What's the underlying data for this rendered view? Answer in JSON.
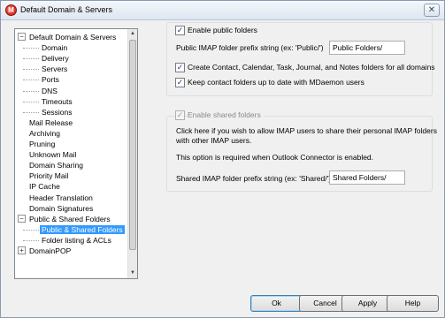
{
  "window": {
    "title": "Default Domain & Servers",
    "close_glyph": "✕"
  },
  "tree": {
    "items": [
      {
        "label": "Default Domain & Servers",
        "level": 0,
        "expander": "−"
      },
      {
        "label": "Domain",
        "level": 1
      },
      {
        "label": "Delivery",
        "level": 1
      },
      {
        "label": "Servers",
        "level": 1
      },
      {
        "label": "Ports",
        "level": 1
      },
      {
        "label": "DNS",
        "level": 1
      },
      {
        "label": "Timeouts",
        "level": 1
      },
      {
        "label": "Sessions",
        "level": 1
      },
      {
        "label": "Mail Release",
        "level": 0
      },
      {
        "label": "Archiving",
        "level": 0
      },
      {
        "label": "Pruning",
        "level": 0
      },
      {
        "label": "Unknown Mail",
        "level": 0
      },
      {
        "label": "Domain Sharing",
        "level": 0
      },
      {
        "label": "Priority Mail",
        "level": 0
      },
      {
        "label": "IP Cache",
        "level": 0
      },
      {
        "label": "Header Translation",
        "level": 0
      },
      {
        "label": "Domain Signatures",
        "level": 0
      },
      {
        "label": "Public & Shared Folders",
        "level": 0,
        "expander": "−"
      },
      {
        "label": "Public & Shared Folders",
        "level": 1,
        "selected": true
      },
      {
        "label": "Folder listing & ACLs",
        "level": 1
      },
      {
        "label": "DomainPOP",
        "level": 0,
        "expander": "+"
      }
    ]
  },
  "public": {
    "enable_label": "Enable public folders",
    "enable_checked": true,
    "prefix_label": "Public IMAP folder prefix string (ex: 'Public/')",
    "prefix_value": "Public Folders/",
    "create_label": "Create Contact, Calendar, Task, Journal, and Notes folders for all domains",
    "create_checked": true,
    "keep_label": "Keep contact folders up to date with MDaemon users",
    "keep_checked": true
  },
  "shared": {
    "enable_label": "Enable shared folders",
    "enable_checked": true,
    "desc_line1": "Click here if you wish to allow IMAP users to share their personal IMAP folders",
    "desc_line2": "with other IMAP users.",
    "note": "This option is required when Outlook Connector is enabled.",
    "prefix_label": "Shared IMAP folder prefix string (ex: 'Shared/')",
    "prefix_value": "Shared Folders/"
  },
  "buttons": {
    "ok": "Ok",
    "cancel": "Cancel",
    "apply": "Apply",
    "help": "Help"
  },
  "glyphs": {
    "check": "✓",
    "arrow_up": "▲",
    "arrow_down": "▼",
    "app_icon": "M"
  }
}
